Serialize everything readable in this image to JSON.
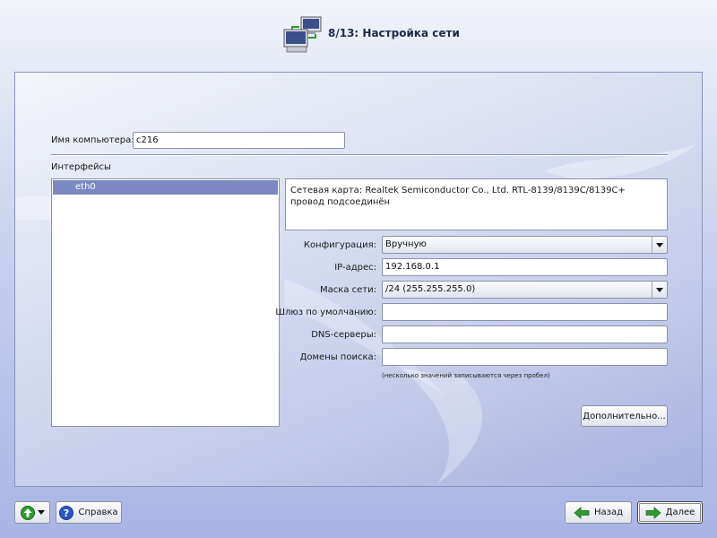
{
  "header": {
    "title": "8/13: Настройка сети",
    "icon": "network-computers-icon"
  },
  "form": {
    "hostname_label": "Имя компьютера:",
    "hostname_value": "c216",
    "interfaces_label": "Интерфейсы",
    "interfaces": [
      "eth0"
    ],
    "info_line1": "Сетевая карта: Realtek Semiconductor Co., Ltd. RTL-8139/8139C/8139C+",
    "info_line2": "провод подсоединён",
    "config_label": "Конфигурация:",
    "config_value": "Вручную",
    "ip_label": "IP-адрес:",
    "ip_value": "192.168.0.1",
    "mask_label": "Маска сети:",
    "mask_value": "/24 (255.255.255.0)",
    "gateway_label": "Шлюз по умолчанию:",
    "gateway_value": "",
    "dns_label": "DNS-серверы:",
    "dns_value": "",
    "domains_label": "Домены поиска:",
    "domains_value": "",
    "hint": "(несколько значений записываются через пробел)",
    "advanced_button": "Дополнительно..."
  },
  "footer": {
    "help_button": "Справка",
    "back_button": "Назад",
    "next_button": "Далее"
  },
  "colors": {
    "selection": "#7c88c2",
    "arrow_green": "#2f9a2f",
    "help_blue": "#2a56c8"
  }
}
